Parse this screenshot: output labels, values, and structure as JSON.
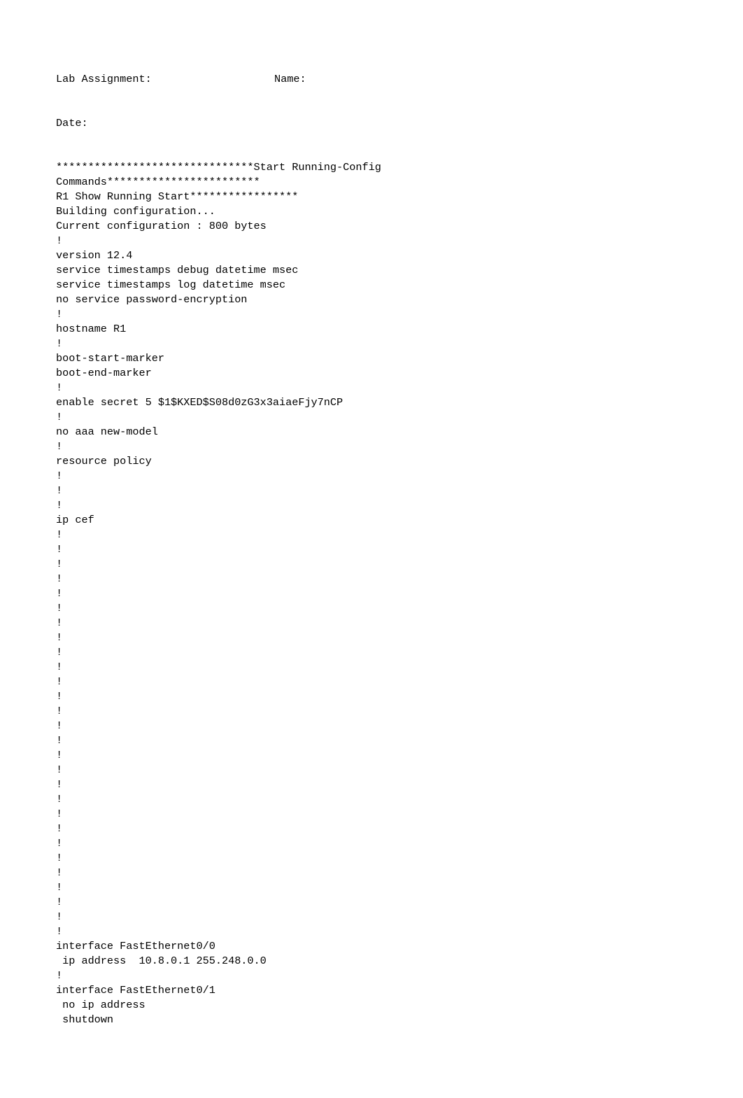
{
  "header": {
    "assignment_label": "Lab Assignment:",
    "name_label": "Name:",
    "date_label": "Date:"
  },
  "config": {
    "lines": [
      "",
      "*******************************Start Running-Config",
      "Commands************************",
      "R1 Show Running Start*****************",
      "Building configuration...",
      "Current configuration : 800 bytes",
      "!",
      "version 12.4",
      "service timestamps debug datetime msec",
      "service timestamps log datetime msec",
      "no service password-encryption",
      "!",
      "hostname R1",
      "!",
      "boot-start-marker",
      "boot-end-marker",
      "!",
      "enable secret 5 $1$KXED$S08d0zG3x3aiaeFjy7nCP",
      "!",
      "no aaa new-model",
      "!",
      "resource policy",
      "!",
      "!",
      "!",
      "ip cef",
      "!",
      "!",
      "!",
      "!",
      "!",
      "!",
      "!",
      "!",
      "!",
      "!",
      "!",
      "!",
      "!",
      "!",
      "!",
      "!",
      "!",
      "!",
      "!",
      "!",
      "!",
      "!",
      "!",
      "!",
      "!",
      "!",
      "!",
      "!",
      "interface FastEthernet0/0",
      " ip address  10.8.0.1 255.248.0.0",
      "!",
      "interface FastEthernet0/1",
      " no ip address",
      " shutdown"
    ]
  }
}
